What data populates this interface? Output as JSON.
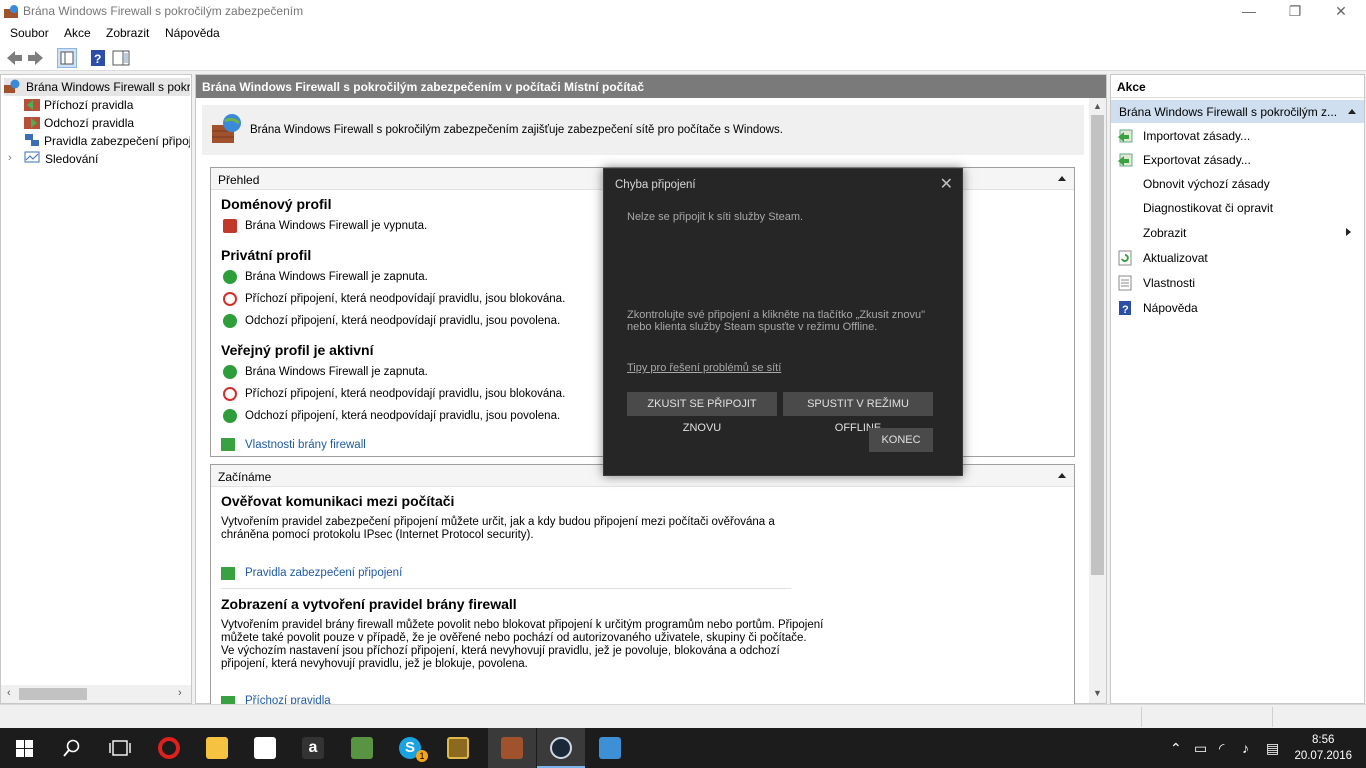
{
  "window": {
    "title": "Brána Windows Firewall s pokročilým zabezpečením",
    "minimize": "—",
    "restore": "❐",
    "close": "✕"
  },
  "menu": [
    "Soubor",
    "Akce",
    "Zobrazit",
    "Nápověda"
  ],
  "tree": {
    "root": "Brána Windows Firewall s pokro",
    "items": [
      "Příchozí pravidla",
      "Odchozí pravidla",
      "Pravidla zabezpečení připoje",
      "Sledování"
    ]
  },
  "main": {
    "header": "Brána Windows Firewall s pokročilým zabezpečením v počítači Místní počítač",
    "intro": "Brána Windows Firewall s pokročilým zabezpečením zajišťuje zabezpečení sítě pro počítače s Windows.",
    "overview": {
      "title": "Přehled",
      "domain_profile": "Doménový profil",
      "domain_status": "Brána Windows Firewall je vypnuta.",
      "private_profile": "Privátní profil",
      "private_lines": [
        "Brána Windows Firewall je zapnuta.",
        "Příchozí připojení, která neodpovídají pravidlu, jsou blokována.",
        "Odchozí připojení, která neodpovídají pravidlu, jsou povolena."
      ],
      "public_profile": "Veřejný profil je aktivní",
      "public_lines": [
        "Brána Windows Firewall je zapnuta.",
        "Příchozí připojení, která neodpovídají pravidlu, jsou blokována.",
        "Odchozí připojení, která neodpovídají pravidlu, jsou povolena."
      ],
      "properties_link": "Vlastnosti brány firewall"
    },
    "getting_started": {
      "title": "Začínáme",
      "h_auth": "Ověřovat komunikaci mezi počítači",
      "p_auth_1": "Vytvořením pravidel zabezpečení připojení můžete určit, jak a kdy budou připojení mezi počítači ověřována a",
      "p_auth_2": "chráněna pomocí protokolu IPsec (Internet Protocol security).",
      "link_auth": "Pravidla zabezpečení připojení",
      "h_rules": "Zobrazení a vytvoření pravidel brány firewall",
      "p_rules_1": "Vytvořením pravidel brány firewall můžete povolit nebo blokovat připojení k určitým programům nebo portům. Připojení",
      "p_rules_2": "můžete také povolit pouze v případě, že je ověřené nebo pochází od autorizovaného uživatele, skupiny či počítače.",
      "p_rules_3": "Ve výchozím nastavení jsou příchozí připojení, která nevyhovují pravidlu, jež je povoluje, blokována a odchozí",
      "p_rules_4": "připojení, která nevyhovují pravidlu, jež je blokuje, povolena.",
      "link_rules": "Příchozí pravidla"
    }
  },
  "actions": {
    "header": "Akce",
    "section": "Brána Windows Firewall s pokročilým z...",
    "items": [
      "Importovat zásady...",
      "Exportovat zásady...",
      "Obnovit výchozí zásady",
      "Diagnostikovat či opravit",
      "Zobrazit",
      "Aktualizovat",
      "Vlastnosti",
      "Nápověda"
    ]
  },
  "dialog": {
    "title": "Chyba připojení",
    "close": "✕",
    "message": "Nelze se připojit k síti služby Steam.",
    "info_1": "Zkontrolujte své připojení a klikněte na tlačítko „Zkusit znovu\"",
    "info_2": "nebo klienta služby Steam spusťte v režimu Offline.",
    "tips_link": "Tipy pro řešení problémů se sítí",
    "retry_button": "ZKUSIT SE PŘIPOJIT ZNOVU",
    "offline_button": "SPUSTIT V REŽIMU OFFLINE",
    "quit_button": "KONEC"
  },
  "taskbar": {
    "time": "8:56",
    "date": "20.07.2016",
    "skype_badge": "1"
  },
  "colors": {
    "accent": "#1e5aa8",
    "header_gray": "#7a7a7a",
    "dialog_bg": "#262626",
    "taskbar": "#1c1c1c"
  }
}
